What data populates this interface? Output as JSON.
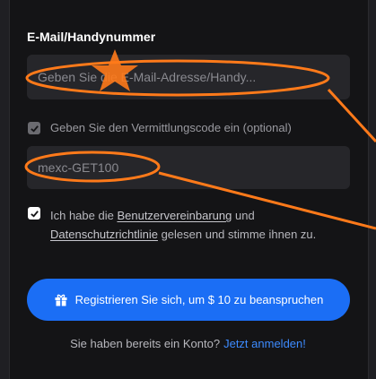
{
  "form": {
    "email_label": "E-Mail/Handynummer",
    "email_placeholder": "Geben Sie die E-Mail-Adresse/Handy...",
    "referral_label": "Geben Sie den Vermittlungscode ein (optional)",
    "referral_value": "mexc-GET100",
    "terms": {
      "prefix": "Ich habe die ",
      "user_agreement": "Benutzervereinbarung",
      "and": " und ",
      "privacy_policy": "Datenschutzrichtlinie",
      "suffix": " gelesen und stimme ihnen zu."
    },
    "register_button": "Registrieren Sie sich, um $ 10 zu beanspruchen",
    "have_account": "Sie haben bereits ein Konto?",
    "login_link": "Jetzt anmelden!"
  },
  "annotation": {
    "color": "#ff7a1a"
  },
  "icons": [
    "check-icon",
    "gift-icon",
    "star-icon"
  ],
  "state": {
    "referral_checked": true,
    "terms_checked": true
  }
}
